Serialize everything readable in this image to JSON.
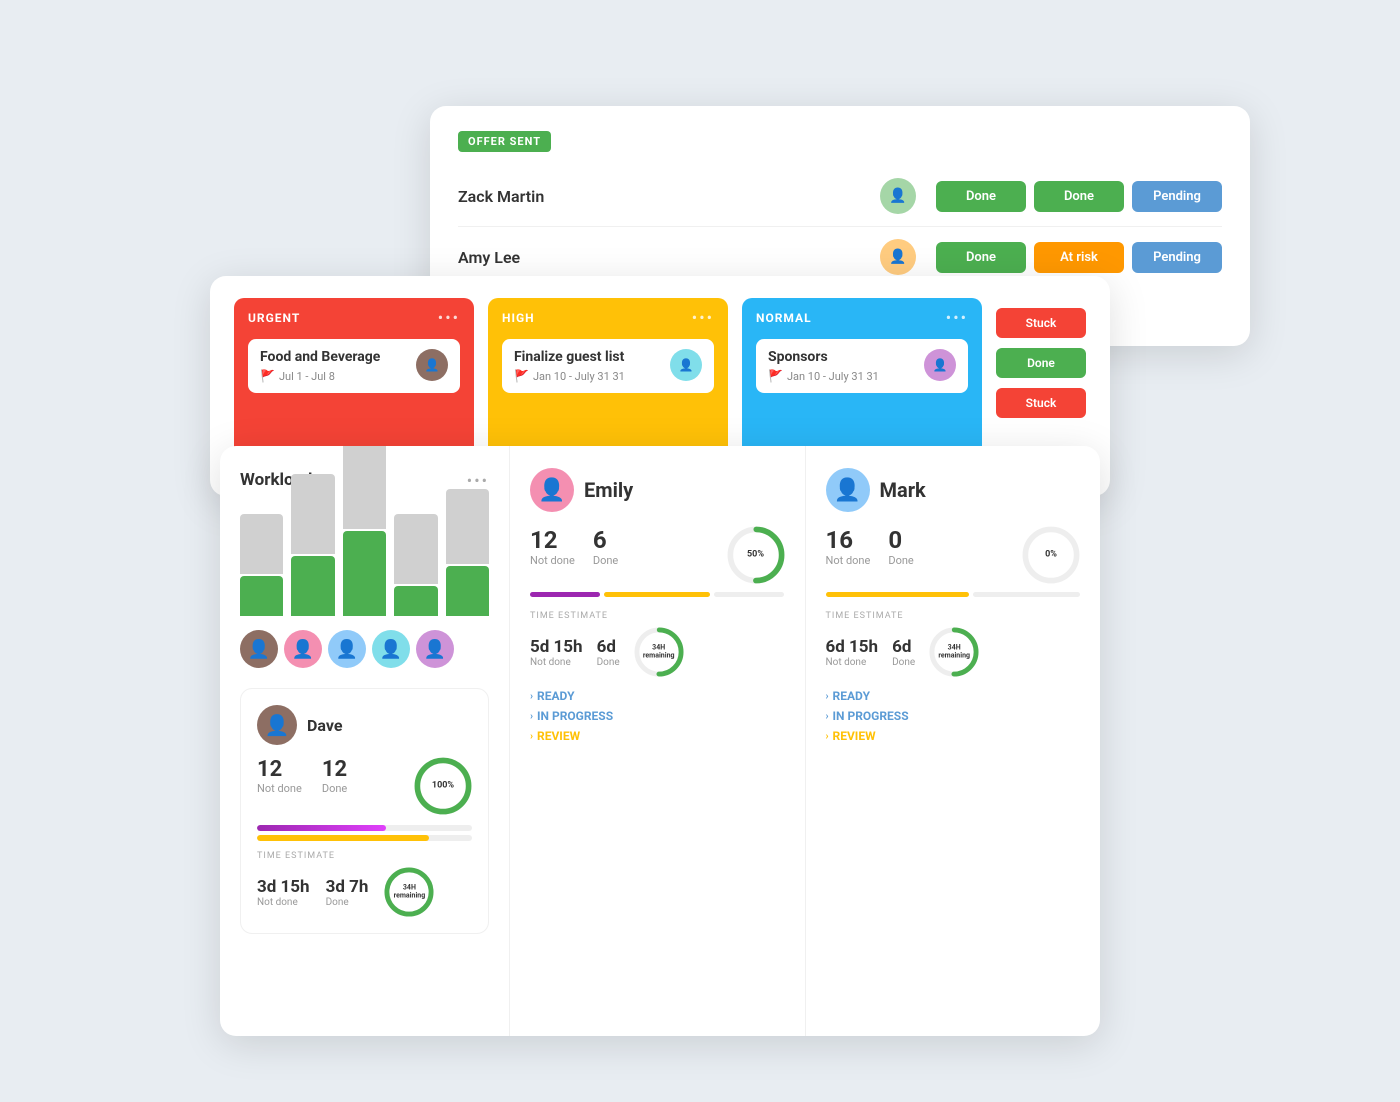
{
  "offer_card": {
    "badge": "OFFER SENT",
    "rows": [
      {
        "name": "Zack Martin",
        "statuses": [
          {
            "label": "Done",
            "color": "green"
          },
          {
            "label": "Done",
            "color": "green"
          },
          {
            "label": "Pending",
            "color": "blue"
          }
        ]
      },
      {
        "name": "Amy Lee",
        "statuses": [
          {
            "label": "Done",
            "color": "green"
          },
          {
            "label": "At risk",
            "color": "orange"
          },
          {
            "label": "Pending",
            "color": "blue"
          }
        ]
      }
    ]
  },
  "kanban": {
    "columns": [
      {
        "id": "urgent",
        "label": "URGENT",
        "task_title": "Food and Beverage",
        "task_date": "Jul 1 - Jul 8",
        "flag": "red"
      },
      {
        "id": "high",
        "label": "HIGH",
        "task_title": "Finalize guest list",
        "task_date": "Jan 10 - July 31 31",
        "flag": "yellow"
      },
      {
        "id": "normal",
        "label": "NORMAL",
        "task_title": "Sponsors",
        "task_date": "Jan 10 - July 31 31",
        "flag": "grey"
      }
    ],
    "right_statuses": [
      {
        "label": "Stuck",
        "color": "#f44336"
      },
      {
        "label": "Done",
        "color": "#4CAF50"
      },
      {
        "label": "Stuck",
        "color": "#f44336"
      }
    ]
  },
  "workload": {
    "title": "Workload",
    "bars": [
      {
        "grey": 60,
        "green": 40
      },
      {
        "grey": 80,
        "green": 60
      },
      {
        "grey": 90,
        "green": 85
      },
      {
        "grey": 70,
        "green": 30
      },
      {
        "grey": 75,
        "green": 50
      }
    ],
    "dave": {
      "name": "Dave",
      "not_done": 12,
      "done": 12,
      "not_done_label": "Not done",
      "done_label": "Done",
      "donut_pct": 100,
      "donut_label": "100%",
      "time_label": "TIME ESTIMATE",
      "time_not_done": "3d 15h",
      "time_done": "3d 7h",
      "time_nd_label": "Not done",
      "time_d_label": "Done",
      "time_remaining": "34H",
      "time_rem_label": "remaining"
    }
  },
  "emily": {
    "name": "Emily",
    "not_done": 12,
    "done": 6,
    "not_done_label": "Not done",
    "done_label": "Done",
    "donut_pct": 50,
    "donut_label": "50%",
    "time_label": "TIME ESTIMATE",
    "time_not_done": "5d 15h",
    "time_done": "6d",
    "time_nd_label": "Not done",
    "time_d_label": "Done",
    "time_remaining": "34H",
    "time_rem_label": "remaining",
    "sections": [
      {
        "label": "READY"
      },
      {
        "label": "IN PROGRESS"
      },
      {
        "label": "REVIEW"
      }
    ]
  },
  "mark": {
    "name": "Mark",
    "not_done": 16,
    "done": 0,
    "not_done_label": "Not done",
    "done_label": "Done",
    "donut_pct": 0,
    "donut_label": "0%",
    "time_label": "TIME ESTIMATE",
    "time_not_done": "6d 15h",
    "time_done": "6d",
    "time_nd_label": "Not done",
    "time_d_label": "Done",
    "time_remaining": "34H",
    "time_rem_label": "remaining",
    "sections": [
      {
        "label": "READY"
      },
      {
        "label": "IN PROGRESS"
      },
      {
        "label": "REVIEW"
      }
    ]
  }
}
